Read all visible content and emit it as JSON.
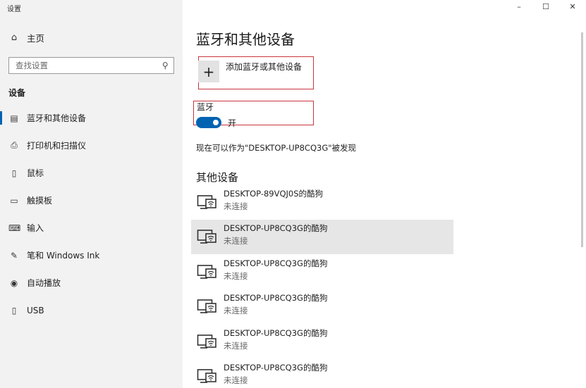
{
  "window": {
    "title": "设置",
    "controls": {
      "minimize": "–",
      "maximize": "☐",
      "close": "✕"
    }
  },
  "sidebar": {
    "home": {
      "label": "主页",
      "icon": "home-icon"
    },
    "search": {
      "placeholder": "查找设置",
      "value": ""
    },
    "section_title": "设备",
    "items": [
      {
        "label": "蓝牙和其他设备",
        "icon": "bluetooth-devices-icon",
        "active": true
      },
      {
        "label": "打印机和扫描仪",
        "icon": "printer-icon",
        "active": false
      },
      {
        "label": "鼠标",
        "icon": "mouse-icon",
        "active": false
      },
      {
        "label": "触摸板",
        "icon": "touchpad-icon",
        "active": false
      },
      {
        "label": "输入",
        "icon": "keyboard-icon",
        "active": false
      },
      {
        "label": "笔和 Windows Ink",
        "icon": "pen-icon",
        "active": false
      },
      {
        "label": "自动播放",
        "icon": "autoplay-icon",
        "active": false
      },
      {
        "label": "USB",
        "icon": "usb-icon",
        "active": false
      }
    ]
  },
  "main": {
    "title": "蓝牙和其他设备",
    "add_device": {
      "label": "添加蓝牙或其他设备",
      "icon": "plus-icon"
    },
    "bluetooth": {
      "label": "蓝牙",
      "state": "开",
      "on": true
    },
    "discoverable_text": "现在可以作为\"DESKTOP-UP8CQ3G\"被发现",
    "other_devices_title": "其他设备",
    "devices": [
      {
        "name": "DESKTOP-89VQJ0S的酷狗",
        "status": "未连接",
        "selected": false
      },
      {
        "name": "DESKTOP-UP8CQ3G的酷狗",
        "status": "未连接",
        "selected": true
      },
      {
        "name": "DESKTOP-UP8CQ3G的酷狗",
        "status": "未连接",
        "selected": false
      },
      {
        "name": "DESKTOP-UP8CQ3G的酷狗",
        "status": "未连接",
        "selected": false
      },
      {
        "name": "DESKTOP-UP8CQ3G的酷狗",
        "status": "未连接",
        "selected": false
      },
      {
        "name": "DESKTOP-UP8CQ3G的酷狗",
        "status": "未连接",
        "selected": false
      }
    ]
  },
  "colors": {
    "accent": "#0063b1",
    "highlight_box": "#c8343c",
    "sidebar_bg": "#f2f2f2",
    "selected_row_bg": "#e6e6e6"
  }
}
